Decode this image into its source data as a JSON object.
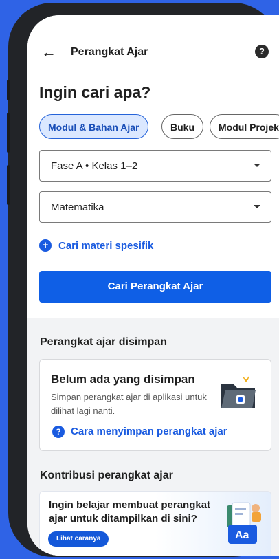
{
  "appbar": {
    "title": "Perangkat Ajar",
    "back_icon": "arrow-left-icon",
    "help_icon": "help-circle-icon"
  },
  "search": {
    "heading": "Ingin cari apa?"
  },
  "chips": [
    {
      "label": "Modul & Bahan Ajar",
      "active": true
    },
    {
      "label": "Buku",
      "active": false
    },
    {
      "label": "Modul Projek",
      "active": false
    }
  ],
  "filters": {
    "fase": "Fase A • Kelas 1–2",
    "subject": "Matematika"
  },
  "specific_link": "Cari materi spesifik",
  "primary_button": "Cari Perangkat Ajar",
  "saved": {
    "title": "Perangkat ajar disimpan",
    "card_title": "Belum ada yang disimpan",
    "card_text": "Simpan perangkat ajar di aplikasi untuk dilihat lagi nanti.",
    "card_link": "Cara menyimpan perangkat ajar"
  },
  "contrib": {
    "title": "Kontribusi perangkat ajar",
    "banner_text": "Ingin belajar membuat perangkat ajar untuk ditampilkan di sini?",
    "banner_button": "Lihat caranya",
    "banner_icon_text": "Aa"
  },
  "colors": {
    "primary": "#0f5fe6",
    "link": "#1a5be0",
    "background": "#2f63e6"
  }
}
